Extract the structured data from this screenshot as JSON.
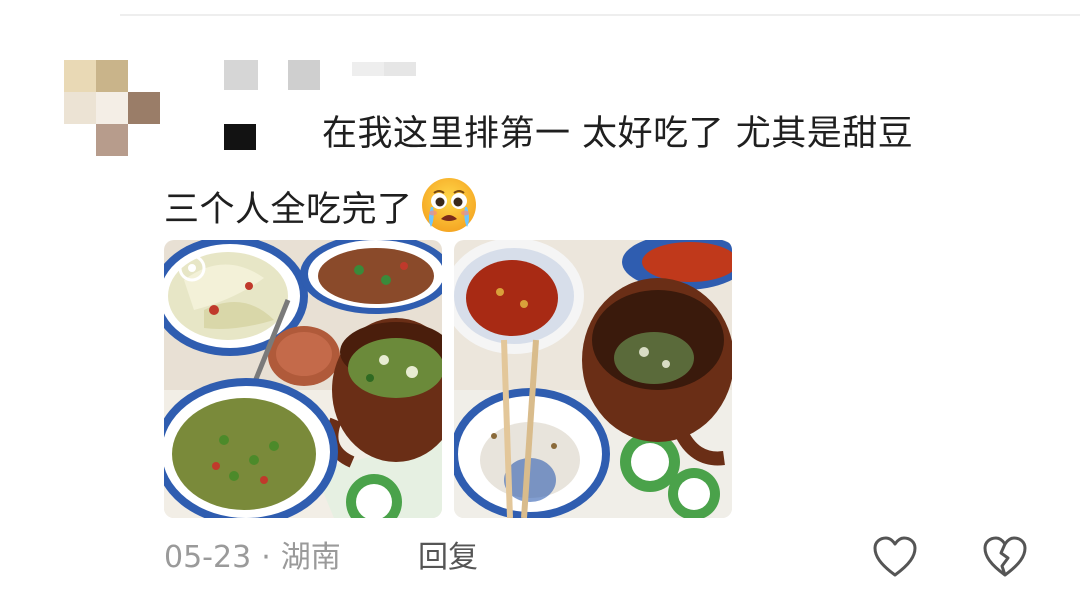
{
  "comment": {
    "text_line1": "在我这里排第一 太好吃了 尤其是甜豆",
    "text_line2": "三个人全吃完了",
    "emoji": "crying-face-emoji"
  },
  "photos": [
    {
      "alt": "photo-1"
    },
    {
      "alt": "photo-2"
    }
  ],
  "meta": {
    "date": "05-23",
    "separator": "·",
    "location": "湖南",
    "reply_label": "回复"
  },
  "icons": {
    "like": "heart-outline-icon",
    "dislike": "broken-heart-icon"
  },
  "colors": {
    "text": "#1f1f1f",
    "meta": "#9a9a9a",
    "reply": "#555555"
  }
}
